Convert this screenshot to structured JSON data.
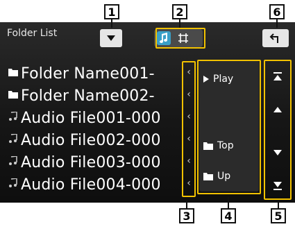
{
  "title": "Folder List",
  "view_toggle": {
    "options": [
      "music-note-icon",
      "frame-icon"
    ],
    "selected": "music-note-icon"
  },
  "rows": [
    {
      "icon": "folder-icon",
      "label": "Folder Name001-"
    },
    {
      "icon": "folder-icon",
      "label": "Folder Name002-"
    },
    {
      "icon": "music-note-icon",
      "label": "Audio File001-000"
    },
    {
      "icon": "music-note-icon",
      "label": "Audio File002-000"
    },
    {
      "icon": "music-note-icon",
      "label": "Audio File003-000"
    },
    {
      "icon": "music-note-icon",
      "label": "Audio File004-000"
    }
  ],
  "commands": {
    "play": "Play",
    "top": "Top",
    "up": "Up"
  },
  "callouts": {
    "c1": "1",
    "c2": "2",
    "c3": "3",
    "c4": "4",
    "c5": "5",
    "c6": "6"
  },
  "colors": {
    "bracket": "#f2c200",
    "screen": "#161616"
  }
}
